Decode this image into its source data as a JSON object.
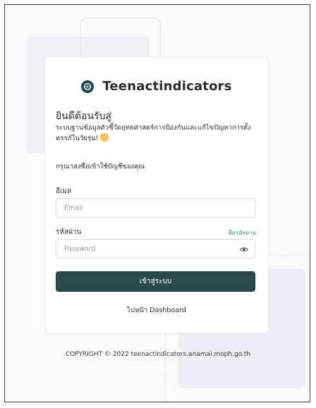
{
  "brand": {
    "name": "Teenactindicators",
    "logo_icon": "shield-emblem-icon",
    "logo_color": "#1b4b4b"
  },
  "welcome": {
    "title": "ยินดีต้อนรับสู่",
    "description": "ระบบฐานข้อมูลตัวชี้วัดยุทธศาสตร์การป้องกันและแก้ไขปัญหาการตั้งครรภ์ในวัยรุ่น!",
    "emoji_icon": "hand-wave-icon",
    "prompt": "กรุณาลงชื่อเข้าใช้บัญชีของคุณ"
  },
  "form": {
    "email_label": "อีเมล",
    "email_placeholder": "Email",
    "password_label": "รหัสผ่าน",
    "forgot_label": "ลืมรหัสผ่าน",
    "password_placeholder": "Password",
    "login_label": "เข้าสู่ระบบ",
    "dashboard_link": "ไปหน้า Dashboard"
  },
  "footer": {
    "copyright": "COPYRIGHT © 2022 teenactindicators.anamai.moph.go.th"
  },
  "colors": {
    "primary_button": "#2b4a4b",
    "link_green": "#2f9a6a"
  }
}
